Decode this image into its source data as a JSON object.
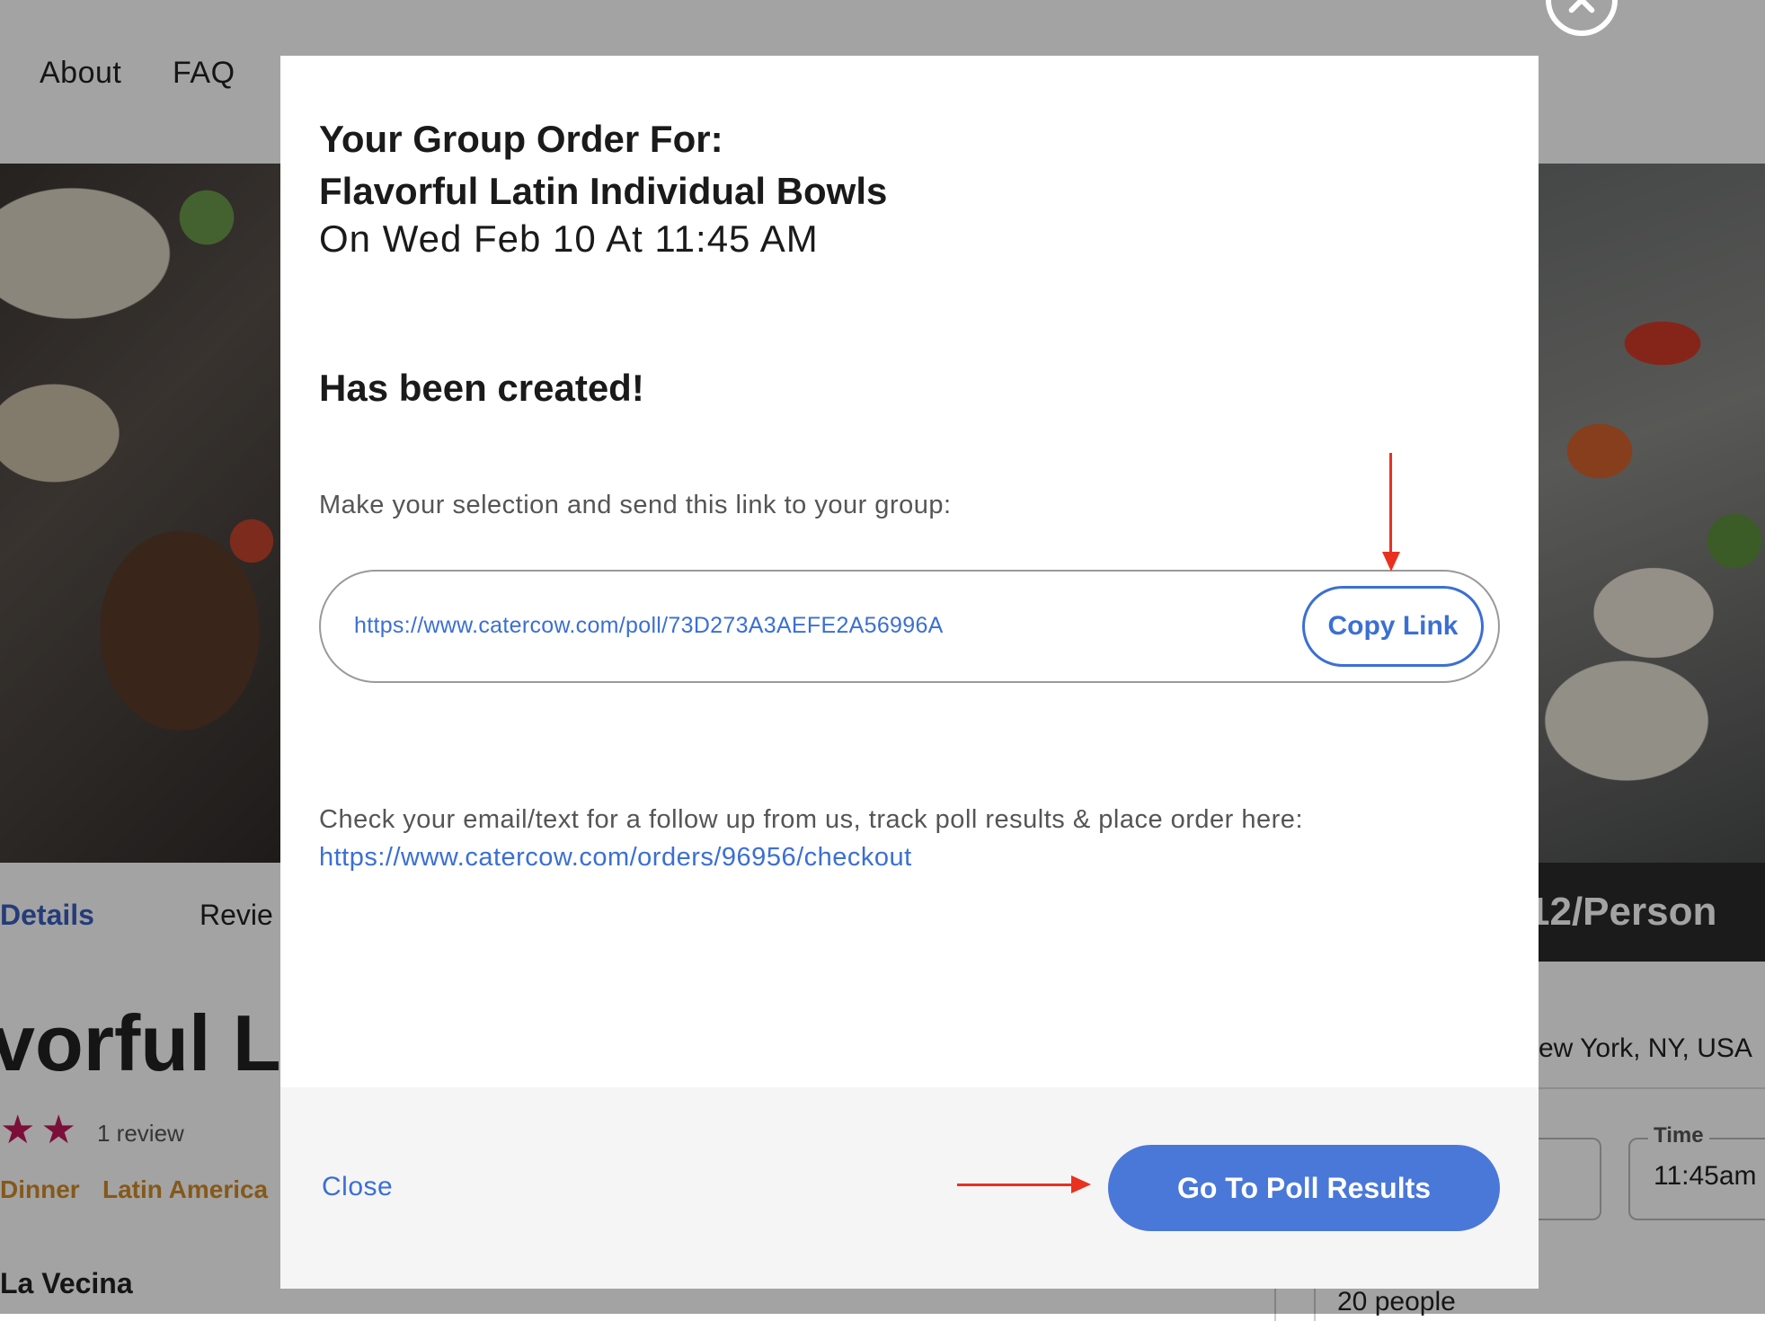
{
  "background_page": {
    "nav": [
      "About",
      "FAQ"
    ],
    "tabs": [
      "Details",
      "Revie"
    ],
    "product_title_fragment": "vorful La",
    "stars": "★★",
    "review_count": "1 review",
    "tags": [
      "Dinner",
      "Latin America"
    ],
    "vendor": "La Vecina",
    "price": "12/Person",
    "location": "ew York, NY, USA",
    "time_label": "Time",
    "time_value": "11:45am",
    "people": "20 people"
  },
  "modal": {
    "title_line1": "Your Group Order For:",
    "title_line2": "Flavorful Latin Individual Bowls",
    "date_line": "On Wed Feb 10 At 11:45 AM",
    "created": "Has been created!",
    "instruction": "Make your selection and send this link to your group:",
    "poll_link": "https://www.catercow.com/poll/73D273A3AEFE2A56996A",
    "copy_button": "Copy Link",
    "followup_text": "Check your email/text for a follow up from us, track poll results & place order here:",
    "checkout_link": "https://www.catercow.com/orders/96956/checkout",
    "close_label": "Close",
    "poll_results_button": "Go To Poll Results"
  },
  "colors": {
    "accent": "#4a78d8",
    "link": "#3b6fd4",
    "annotation_arrow": "#e8321f",
    "star": "#c2185b",
    "tag": "#d08b2a"
  }
}
